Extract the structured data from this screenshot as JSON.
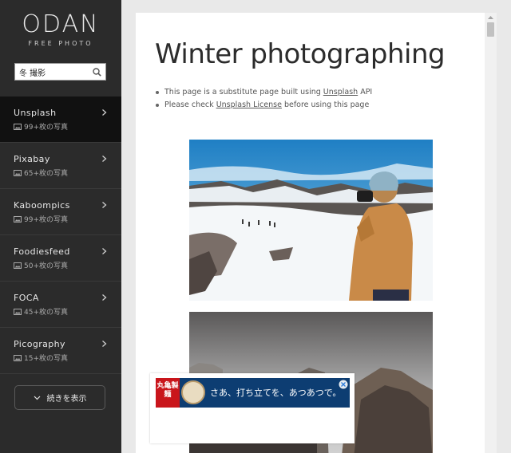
{
  "logo": {
    "main": "ODAN",
    "sub": "FREE PHOTO"
  },
  "search": {
    "value": "冬 撮影"
  },
  "nav": {
    "items": [
      {
        "label": "Unsplash",
        "count": "99+枚の写真"
      },
      {
        "label": "Pixabay",
        "count": "65+枚の写真"
      },
      {
        "label": "Kaboompics",
        "count": "99+枚の写真"
      },
      {
        "label": "Foodiesfeed",
        "count": "50+枚の写真"
      },
      {
        "label": "FOCA",
        "count": "45+枚の写真"
      },
      {
        "label": "Picography",
        "count": "15+枚の写真"
      }
    ],
    "more_label": "続きを表示"
  },
  "main": {
    "title": "Winter photographing",
    "notes": [
      {
        "before": "This page is a substitute page built using ",
        "link": "Unsplash",
        "after": " API"
      },
      {
        "before": "Please check ",
        "link": "Unsplash License",
        "after": " before using this page"
      }
    ]
  },
  "ad": {
    "brand": "丸亀製麺",
    "text": "さあ、打ち立てを、あつあつで。"
  },
  "colors": {
    "sidebar_bg": "#2b2b2b",
    "sidebar_active_bg": "#111111",
    "ad_brand_red": "#c9151b",
    "ad_blue": "#0d3d72"
  }
}
